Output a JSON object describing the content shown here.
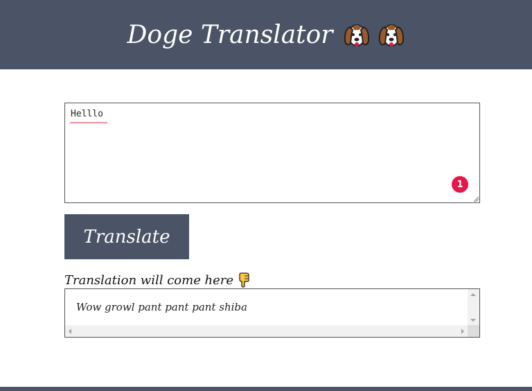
{
  "header": {
    "title": "Doge Translator",
    "icons": [
      "dog-face-icon",
      "dog-face-icon"
    ],
    "background_color": "#4a5466"
  },
  "input": {
    "value": "Helllo",
    "spellcheck_error_count": "1",
    "error_badge_color": "#e8174a"
  },
  "translate_button": {
    "label": "Translate"
  },
  "output": {
    "label": "Translation will come here",
    "label_icon": "pointing-down-hand-icon",
    "text": "Wow growl pant pant pant shiba"
  },
  "colors": {
    "accent": "#4a5466",
    "text": "#222222"
  }
}
